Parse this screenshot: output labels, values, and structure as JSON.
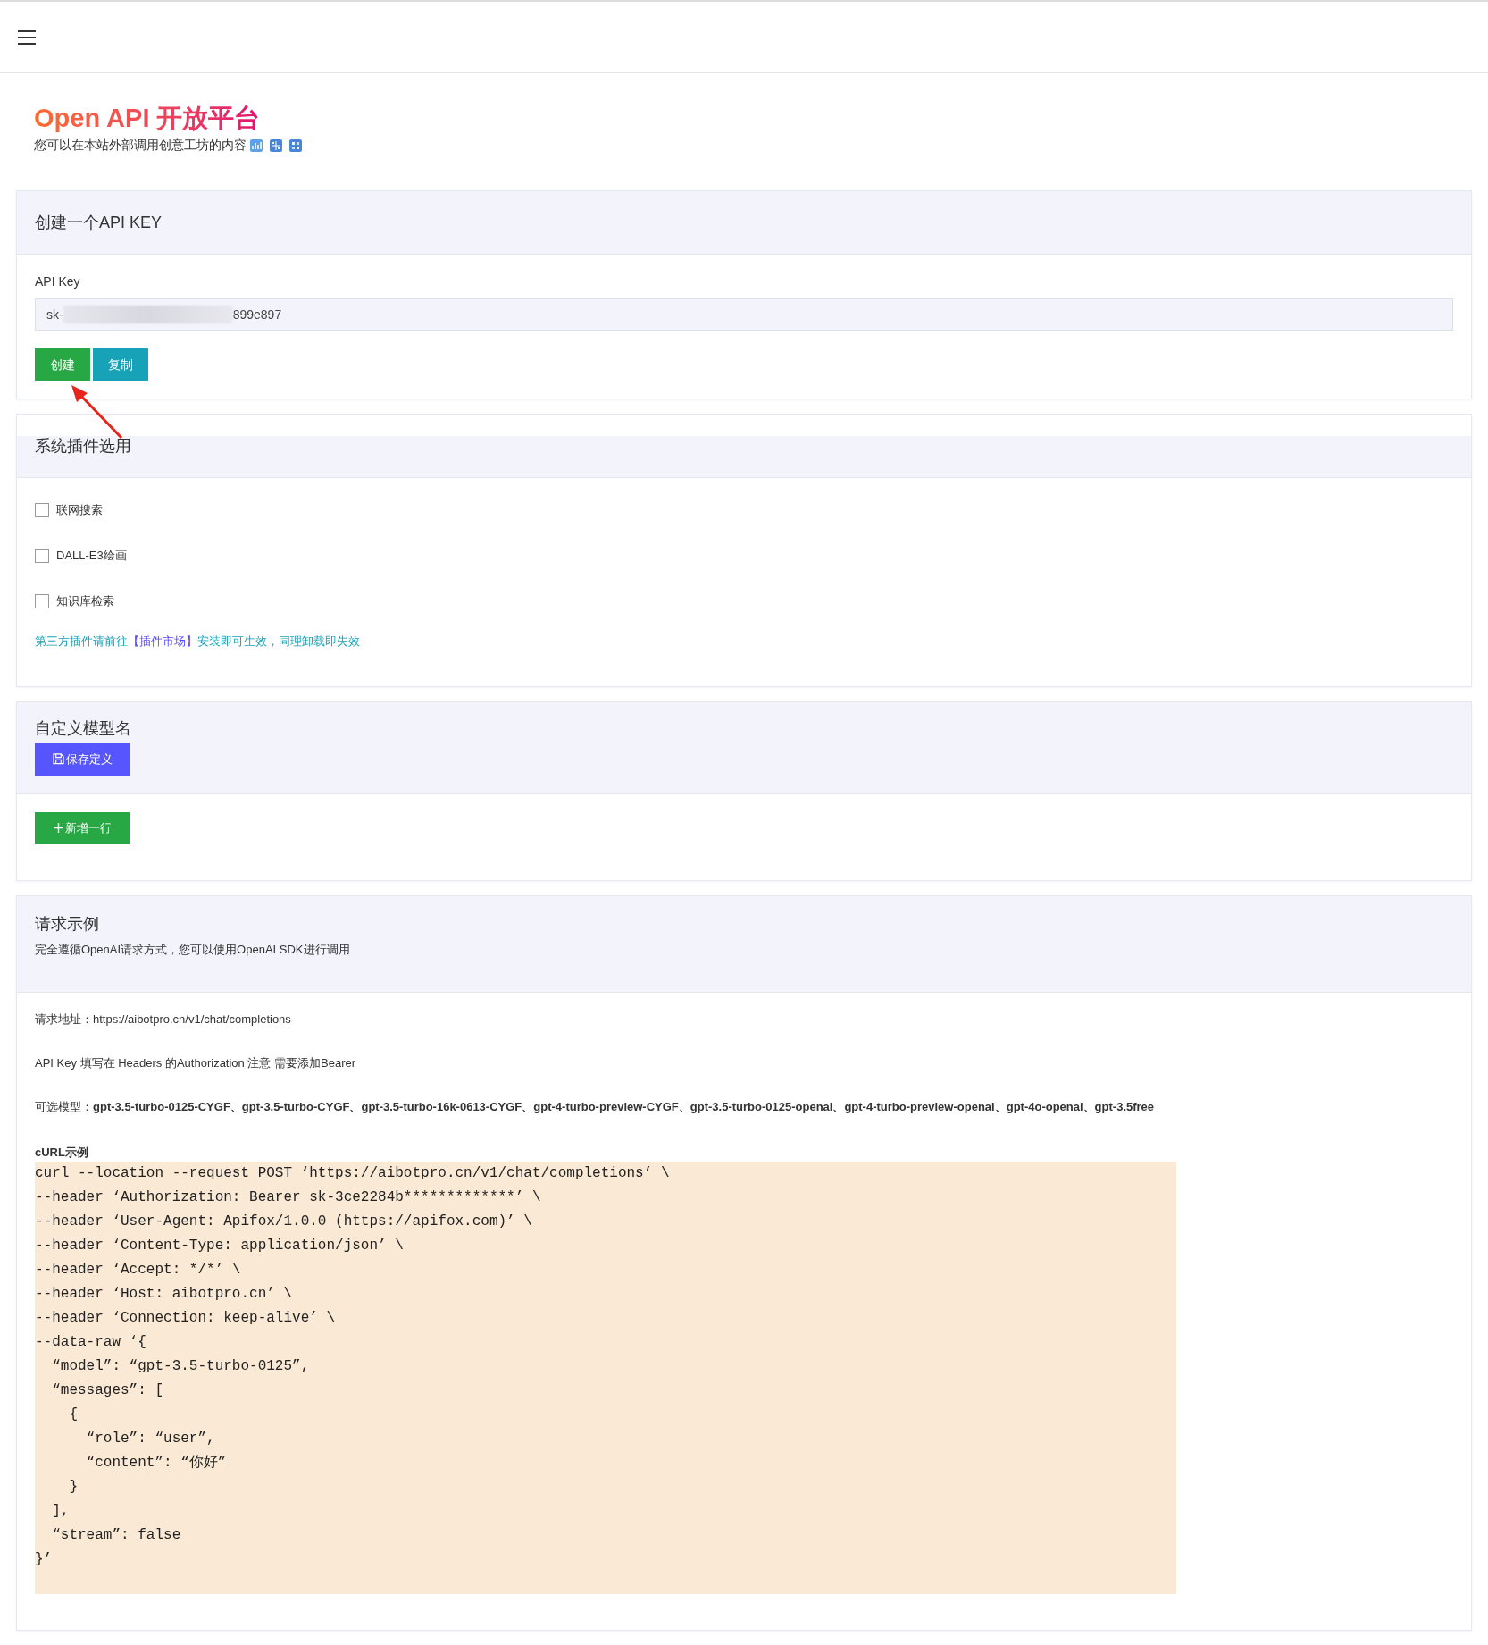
{
  "page": {
    "title": "Open API 开放平台",
    "subtitle": "您可以在本站外部调用创意工坊的内容"
  },
  "api_key_card": {
    "title": "创建一个API KEY",
    "field_label": "API Key",
    "key_prefix": "sk-",
    "key_suffix": "899e897",
    "buttons": [
      {
        "label": "创建",
        "kind": "create"
      },
      {
        "label": "复制",
        "kind": "copy"
      }
    ]
  },
  "plugins_card": {
    "title": "系统插件选用",
    "plugins": [
      {
        "label": "联网搜索",
        "checked": false
      },
      {
        "label": "DALL-E3绘画",
        "checked": false
      },
      {
        "label": "知识库检索",
        "checked": false
      }
    ],
    "note_before": "第三方插件请前往",
    "note_link": "【插件市场】",
    "note_after": "安装即可生效，同理卸载即失效"
  },
  "model_card": {
    "title": "自定义模型名",
    "save_button": "保存定义",
    "add_button": "新增一行"
  },
  "example_card": {
    "title": "请求示例",
    "subtitle": "完全遵循OpenAI请求方式，您可以使用OpenAI SDK进行调用",
    "lines": [
      {
        "label": "请求地址：",
        "value": "https://aibotpro.cn/v1/chat/completions",
        "bold": false
      },
      {
        "value": "API Key 填写在 Headers 的Authorization 注意 需要添加Bearer",
        "bold": false
      },
      {
        "label": "可选模型：",
        "value": "gpt-3.5-turbo-0125-CYGF、gpt-3.5-turbo-CYGF、gpt-3.5-turbo-16k-0613-CYGF、gpt-4-turbo-preview-CYGF、gpt-3.5-turbo-0125-openai、gpt-4-turbo-preview-openai、gpt-4o-openai、gpt-3.5free",
        "bold": true
      }
    ],
    "code_title": "cURL示例",
    "code": [
      "curl --location --request POST ‘https://aibotpro.cn/v1/chat/completions’ \\",
      "--header ‘Authorization: Bearer sk-3ce2284b*************’ \\",
      "--header ‘User-Agent: Apifox/1.0.0 (https://apifox.com)’ \\",
      "--header ‘Content-Type: application/json’ \\",
      "--header ‘Accept: */*’ \\",
      "--header ‘Host: aibotpro.cn’ \\",
      "--header ‘Connection: keep-alive’ \\",
      "--data-raw ‘{",
      "  “model”: “gpt-3.5-turbo-0125”,",
      "  “messages”: [",
      "    {",
      "      “role”: “user”,",
      "      “content”: “你好”",
      "    }",
      "  ],",
      "  “stream”: false",
      "}’"
    ]
  }
}
